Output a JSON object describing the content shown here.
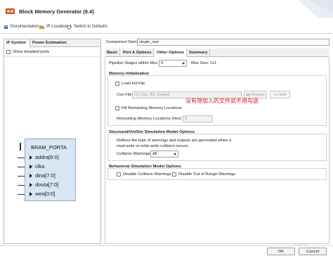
{
  "window": {
    "title": "Block Memory Generator (8.4)"
  },
  "toolbar": {
    "documentation": "Documentation",
    "ip_location": "IP Location",
    "switch_defaults": "Switch to Defaults"
  },
  "left_panel": {
    "tabs": [
      "IP Symbol",
      "Power Estimation"
    ],
    "show_disabled_ports": "Show disabled ports",
    "symbol": {
      "title": "BRAM_PORTA",
      "ports": [
        "addra[6:0]",
        "clka",
        "dina[7:0]",
        "douta[7:0]",
        "wea[0:0]"
      ]
    }
  },
  "component": {
    "label": "Component Name",
    "value": "single_ram"
  },
  "tabs": [
    "Basic",
    "Port A Options",
    "Other Options",
    "Summary"
  ],
  "active_tab": "Other Options",
  "other_options": {
    "pipeline_label": "Pipeline Stages within Mux",
    "pipeline_value": "0",
    "mux_size": "Mux Size: 1x1",
    "memory_init_title": "Memory Initialization",
    "load_init_file": "Load Init File",
    "coe_file_label": "Coe File",
    "coe_file_value": "no_coe_file_loaded",
    "browse": "Browse",
    "edit": "Edit",
    "fill_remaining": "Fill Remaining Memory Locations",
    "remaining_label": "Remaining Memory Locations (Hex)",
    "remaining_value": "0",
    "sim_title": "Structural/UniSim Simulation Model Options",
    "sim_desc_1": "Defines the type of warnings and outputs are generated when a",
    "sim_desc_2": "read-write or write-write collision occurs.",
    "collision_label": "Collision Warnings",
    "collision_value": "All",
    "behav_title": "Behavioral Simulation Model Options",
    "disable_collision": "Disable Collision Warnings",
    "disable_out_of_range": "Disable Out of Range Warnings"
  },
  "annotation": "没有想加入的文件就不用勾选",
  "buttons": {
    "ok": "OK",
    "cancel": "Cancel"
  },
  "watermark": "CSDN @…",
  "colors": {
    "symbol_fill": "#d9e7f4",
    "annotation": "#e01818"
  }
}
